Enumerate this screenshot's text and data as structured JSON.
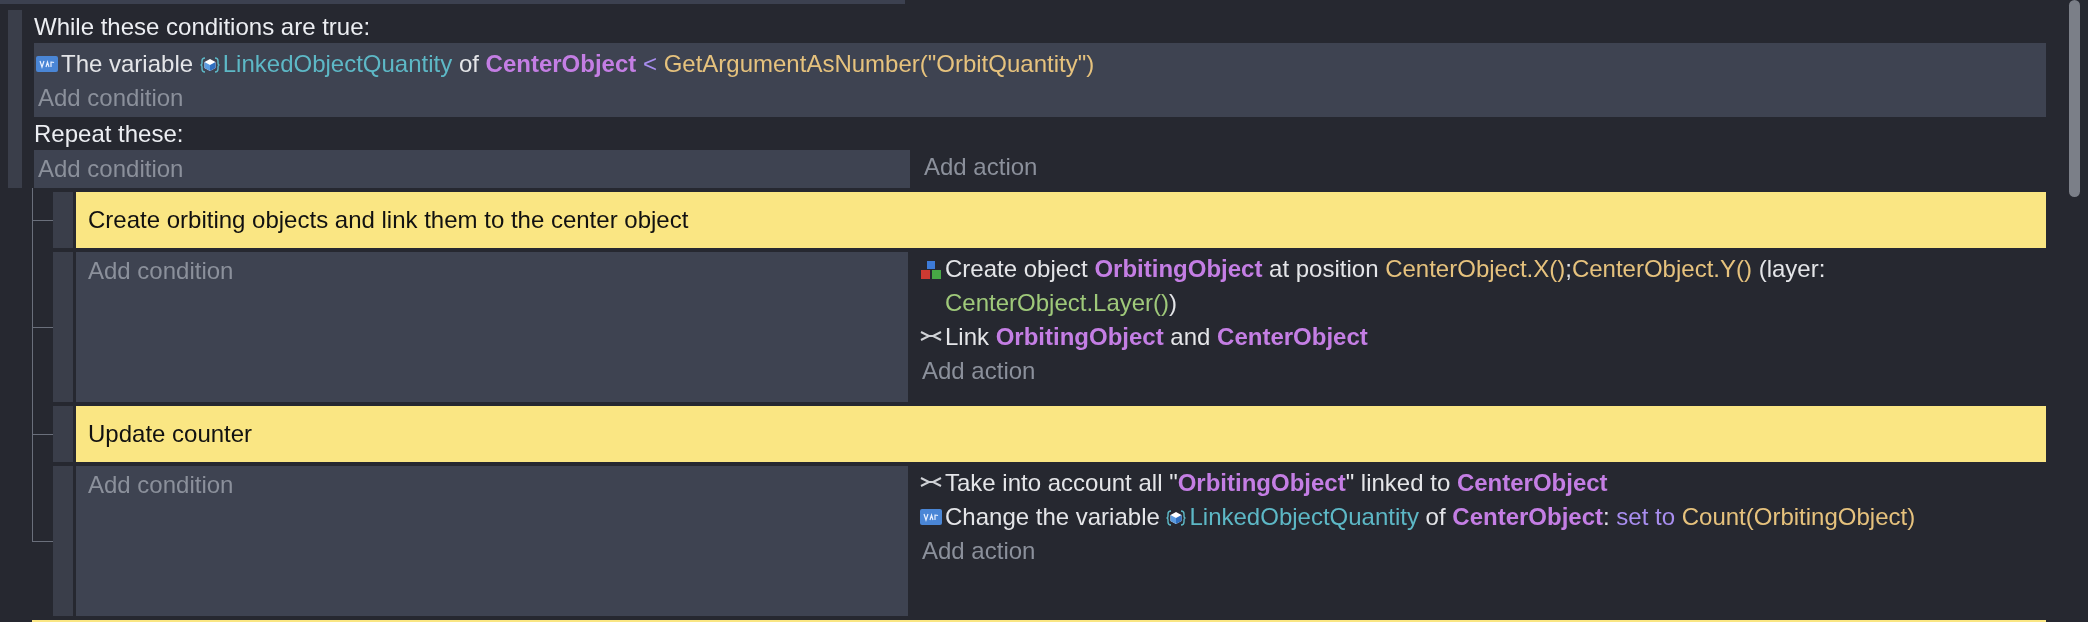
{
  "while_event": {
    "header": "While these conditions are true:",
    "conditions": [
      {
        "kind": "variable",
        "parts": [
          {
            "kind": "plain",
            "text": "The variable "
          },
          {
            "kind": "variable-icon"
          },
          {
            "kind": "variable",
            "text": "LinkedObjectQuantity"
          },
          {
            "kind": "plain",
            "text": " of "
          },
          {
            "kind": "object",
            "text": "CenterObject"
          },
          {
            "kind": "operator",
            "text": " < "
          },
          {
            "kind": "expression",
            "text": "GetArgumentAsNumber(\"OrbitQuantity\")"
          }
        ]
      }
    ],
    "add_condition": "Add condition",
    "repeat_header": "Repeat these:",
    "repeat_add_condition": "Add condition",
    "repeat_add_action": "Add action",
    "sub_events": [
      {
        "kind": "comment",
        "text": "Create orbiting objects and link them to the center object"
      },
      {
        "kind": "standard",
        "add_condition": "Add condition",
        "add_action": "Add action",
        "actions": [
          {
            "kind": "create",
            "parts": [
              {
                "kind": "plain",
                "text": "Create object "
              },
              {
                "kind": "object",
                "text": "OrbitingObject"
              },
              {
                "kind": "plain",
                "text": " at position "
              },
              {
                "kind": "expression",
                "text": "CenterObject.X()"
              },
              {
                "kind": "plain",
                "text": ";"
              },
              {
                "kind": "expression",
                "text": "CenterObject.Y()"
              },
              {
                "kind": "plain",
                "text": " (layer: "
              },
              {
                "kind": "layer",
                "text": "CenterObject.Layer()"
              },
              {
                "kind": "plain",
                "text": ")"
              }
            ]
          },
          {
            "kind": "link",
            "parts": [
              {
                "kind": "plain",
                "text": "Link "
              },
              {
                "kind": "object",
                "text": "OrbitingObject"
              },
              {
                "kind": "plain",
                "text": " and "
              },
              {
                "kind": "object",
                "text": "CenterObject"
              }
            ]
          }
        ]
      },
      {
        "kind": "comment",
        "text": "Update counter"
      },
      {
        "kind": "standard",
        "add_condition": "Add condition",
        "add_action": "Add action",
        "actions": [
          {
            "kind": "link",
            "parts": [
              {
                "kind": "plain",
                "text": "Take into account all \""
              },
              {
                "kind": "object",
                "text": "OrbitingObject"
              },
              {
                "kind": "plain",
                "text": "\" linked to "
              },
              {
                "kind": "object",
                "text": "CenterObject"
              }
            ]
          },
          {
            "kind": "variable",
            "parts": [
              {
                "kind": "plain",
                "text": "Change the variable "
              },
              {
                "kind": "variable-icon"
              },
              {
                "kind": "variable",
                "text": "LinkedObjectQuantity"
              },
              {
                "kind": "plain",
                "text": " of "
              },
              {
                "kind": "object",
                "text": "CenterObject"
              },
              {
                "kind": "plain",
                "text": ": "
              },
              {
                "kind": "operator",
                "text": "set to "
              },
              {
                "kind": "expression",
                "text": "Count(OrbitingObject)"
              }
            ]
          }
        ]
      }
    ]
  }
}
